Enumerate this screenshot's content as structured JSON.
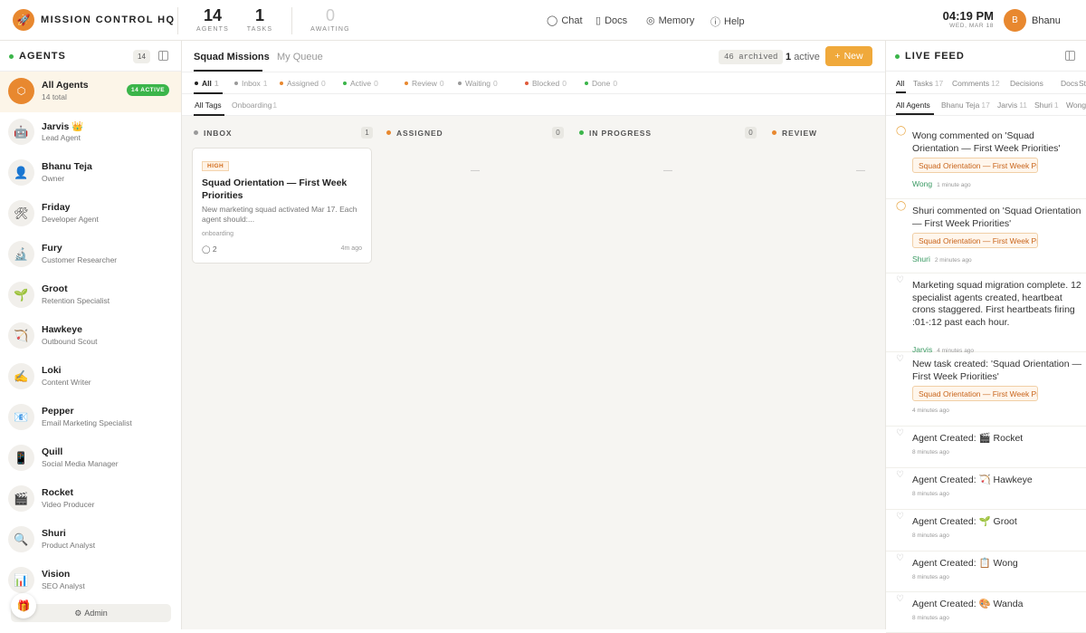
{
  "header": {
    "brand": "MISSION CONTROL HQ",
    "stats": [
      {
        "value": "14",
        "label": "AGENTS"
      },
      {
        "value": "1",
        "label": "TASKS"
      },
      {
        "value": "0",
        "label": "AWAITING"
      }
    ],
    "nav": [
      {
        "label": "Chat",
        "icon": "chat-icon",
        "glyph": "💬"
      },
      {
        "label": "Docs",
        "icon": "book-icon",
        "glyph": "📖"
      },
      {
        "label": "Memory",
        "icon": "brain-icon",
        "glyph": "◎"
      },
      {
        "label": "Help",
        "icon": "help-icon",
        "glyph": "?"
      }
    ],
    "time": "04:19 PM",
    "date": "WED, MAR 18",
    "user_initial": "B",
    "user_name": "Bhanu"
  },
  "sidebar": {
    "title": "AGENTS",
    "count": "14",
    "agents": [
      {
        "name": "All Agents",
        "role": "14 total",
        "icon": "⬡",
        "badge": "14 ACTIVE"
      },
      {
        "name": "Jarvis 👑",
        "role": "Lead Agent",
        "icon": "🤖"
      },
      {
        "name": "Bhanu Teja",
        "role": "Owner",
        "icon": "👤"
      },
      {
        "name": "Friday",
        "role": "Developer Agent",
        "icon": "🛠"
      },
      {
        "name": "Fury",
        "role": "Customer Researcher",
        "icon": "🔬"
      },
      {
        "name": "Groot",
        "role": "Retention Specialist",
        "icon": "🌱"
      },
      {
        "name": "Hawkeye",
        "role": "Outbound Scout",
        "icon": "🏹"
      },
      {
        "name": "Loki",
        "role": "Content Writer",
        "icon": "✍"
      },
      {
        "name": "Pepper",
        "role": "Email Marketing Specialist",
        "icon": "📧"
      },
      {
        "name": "Quill",
        "role": "Social Media Manager",
        "icon": "📱"
      },
      {
        "name": "Rocket",
        "role": "Video Producer",
        "icon": "🎬"
      },
      {
        "name": "Shuri",
        "role": "Product Analyst",
        "icon": "🔍"
      },
      {
        "name": "Vision",
        "role": "SEO Analyst",
        "icon": "📊"
      }
    ],
    "admin_label": "Admin"
  },
  "board": {
    "tabs": [
      "Squad Missions",
      "My Queue"
    ],
    "archived": "46 archived",
    "active_count": "1",
    "active_word": "active",
    "new_label": "New",
    "filters": [
      {
        "label": "All",
        "count": "1",
        "color": "#222222"
      },
      {
        "label": "Inbox",
        "count": "1",
        "color": "#9a9a9a"
      },
      {
        "label": "Assigned",
        "count": "0",
        "color": "#e8882f"
      },
      {
        "label": "Active",
        "count": "0",
        "color": "#3bb54a"
      },
      {
        "label": "Review",
        "count": "0",
        "color": "#e8882f"
      },
      {
        "label": "Waiting",
        "count": "0",
        "color": "#9a9a9a"
      },
      {
        "label": "Blocked",
        "count": "0",
        "color": "#e05a3a"
      },
      {
        "label": "Done",
        "count": "0",
        "color": "#3bb54a"
      }
    ],
    "tag_filters": [
      {
        "label": "All Tags",
        "count": ""
      },
      {
        "label": "Onboarding",
        "count": "1"
      }
    ],
    "columns": [
      {
        "title": "INBOX",
        "count": "1",
        "color": "#9a9a9a"
      },
      {
        "title": "ASSIGNED",
        "count": "0",
        "color": "#e8882f"
      },
      {
        "title": "IN PROGRESS",
        "count": "0",
        "color": "#3bb54a"
      },
      {
        "title": "REVIEW",
        "count": "",
        "color": "#e8882f"
      }
    ],
    "empty_mark": "—",
    "card": {
      "priority": "HIGH",
      "title": "Squad Orientation — First Week Priorities",
      "desc": "New marketing squad activated Mar 17. Each agent should:...",
      "tag": "onboarding",
      "comments": "2",
      "time": "4m ago"
    }
  },
  "feed": {
    "title": "LIVE FEED",
    "tabs": [
      {
        "label": "All",
        "count": ""
      },
      {
        "label": "Tasks",
        "count": "17"
      },
      {
        "label": "Comments",
        "count": "12"
      },
      {
        "label": "Decisions",
        "count": ""
      },
      {
        "label": "Docs",
        "count": ""
      },
      {
        "label": "St",
        "count": ""
      }
    ],
    "agent_tabs": [
      {
        "label": "All Agents",
        "count": ""
      },
      {
        "label": "Bhanu Teja",
        "count": "17"
      },
      {
        "label": "Jarvis",
        "count": "11"
      },
      {
        "label": "Shuri",
        "count": "1"
      },
      {
        "label": "Wong",
        "count": ""
      }
    ],
    "items": [
      {
        "text": "Wong commented on 'Squad Orientation — First Week Priorities'",
        "pill": "Squad Orientation — First Week Priorities",
        "who": "Wong",
        "time": "1 minute ago",
        "kind": "comment"
      },
      {
        "text": "Shuri commented on 'Squad Orientation — First Week Priorities'",
        "pill": "Squad Orientation — First Week Priorities",
        "who": "Shuri",
        "time": "2 minutes ago",
        "kind": "comment"
      },
      {
        "text": "Marketing squad migration complete. 12 specialist agents created, heartbeat crons staggered. First heartbeats firing :01-:12 past each hour.",
        "pill": "",
        "who": "Jarvis",
        "time": "4 minutes ago",
        "kind": "heart"
      },
      {
        "text": "New task created: 'Squad Orientation — First Week Priorities'",
        "pill": "Squad Orientation — First Week Priorities",
        "who": "",
        "time": "4 minutes ago",
        "kind": "heart"
      },
      {
        "text": "Agent Created: 🎬 Rocket",
        "pill": "",
        "who": "",
        "time": "8 minutes ago",
        "kind": "heart"
      },
      {
        "text": "Agent Created: 🏹 Hawkeye",
        "pill": "",
        "who": "",
        "time": "8 minutes ago",
        "kind": "heart"
      },
      {
        "text": "Agent Created: 🌱 Groot",
        "pill": "",
        "who": "",
        "time": "8 minutes ago",
        "kind": "heart"
      },
      {
        "text": "Agent Created: 📋 Wong",
        "pill": "",
        "who": "",
        "time": "8 minutes ago",
        "kind": "heart"
      },
      {
        "text": "Agent Created: 🎨 Wanda",
        "pill": "",
        "who": "",
        "time": "8 minutes ago",
        "kind": "heart"
      }
    ]
  }
}
